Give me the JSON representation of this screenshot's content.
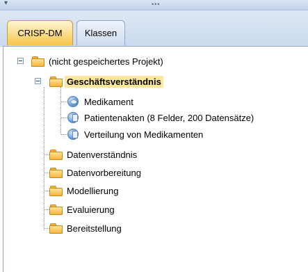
{
  "tabs": [
    {
      "label": "CRISP-DM",
      "active": true
    },
    {
      "label": "Klassen",
      "active": false
    }
  ],
  "tree": {
    "root": "(nicht gespeichertes Projekt)",
    "phases": [
      {
        "label": "Geschäftsverständnis",
        "selected": true,
        "children": [
          "Medikament",
          "Patientenakten (8 Felder, 200 Datensätze)",
          "Verteilung von Medikamenten"
        ]
      },
      {
        "label": "Datenverständnis"
      },
      {
        "label": "Datenvorbereitung"
      },
      {
        "label": "Modellierung"
      },
      {
        "label": "Evaluierung"
      },
      {
        "label": "Bereitstellung"
      }
    ]
  },
  "icons": {
    "folder": "folder-icon",
    "collapse": "collapse-icon",
    "datasource": "data-source-icon"
  },
  "colors": {
    "active_tab": "#f7c64a",
    "selection": "#fde79a",
    "panel_border": "#8fa4c6"
  }
}
